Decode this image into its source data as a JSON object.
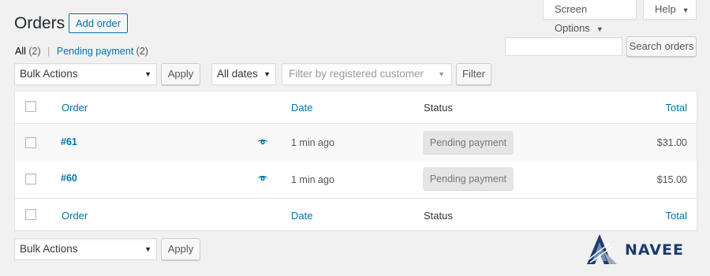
{
  "screen_options": {
    "label": "Screen Options",
    "caret": "▼"
  },
  "help": {
    "label": "Help",
    "caret": "▼"
  },
  "page_title": "Orders",
  "add_order_label": "Add order",
  "views": {
    "all_label": "All",
    "all_count": "(2)",
    "separator": "|",
    "pending_label": "Pending payment",
    "pending_count": "(2)"
  },
  "search": {
    "button_label": "Search orders",
    "value": ""
  },
  "top_actions": {
    "bulk_actions": "Bulk Actions",
    "apply_label": "Apply",
    "dates": "All dates",
    "customer_placeholder": "Filter by registered customer",
    "filter_label": "Filter"
  },
  "columns": {
    "order": "Order",
    "date": "Date",
    "status": "Status",
    "total": "Total"
  },
  "orders": [
    {
      "number": "#61",
      "date": "1 min ago",
      "status": "Pending payment",
      "total": "$31.00"
    },
    {
      "number": "#60",
      "date": "1 min ago",
      "status": "Pending payment",
      "total": "$15.00"
    }
  ],
  "bottom_actions": {
    "bulk_actions": "Bulk Actions",
    "apply_label": "Apply"
  },
  "logo_text": "NAVEE",
  "colors": {
    "link": "#0073aa",
    "background": "#f1f1f1",
    "badge_bg": "#e5e5e5",
    "logo": "#1d3a6e"
  }
}
